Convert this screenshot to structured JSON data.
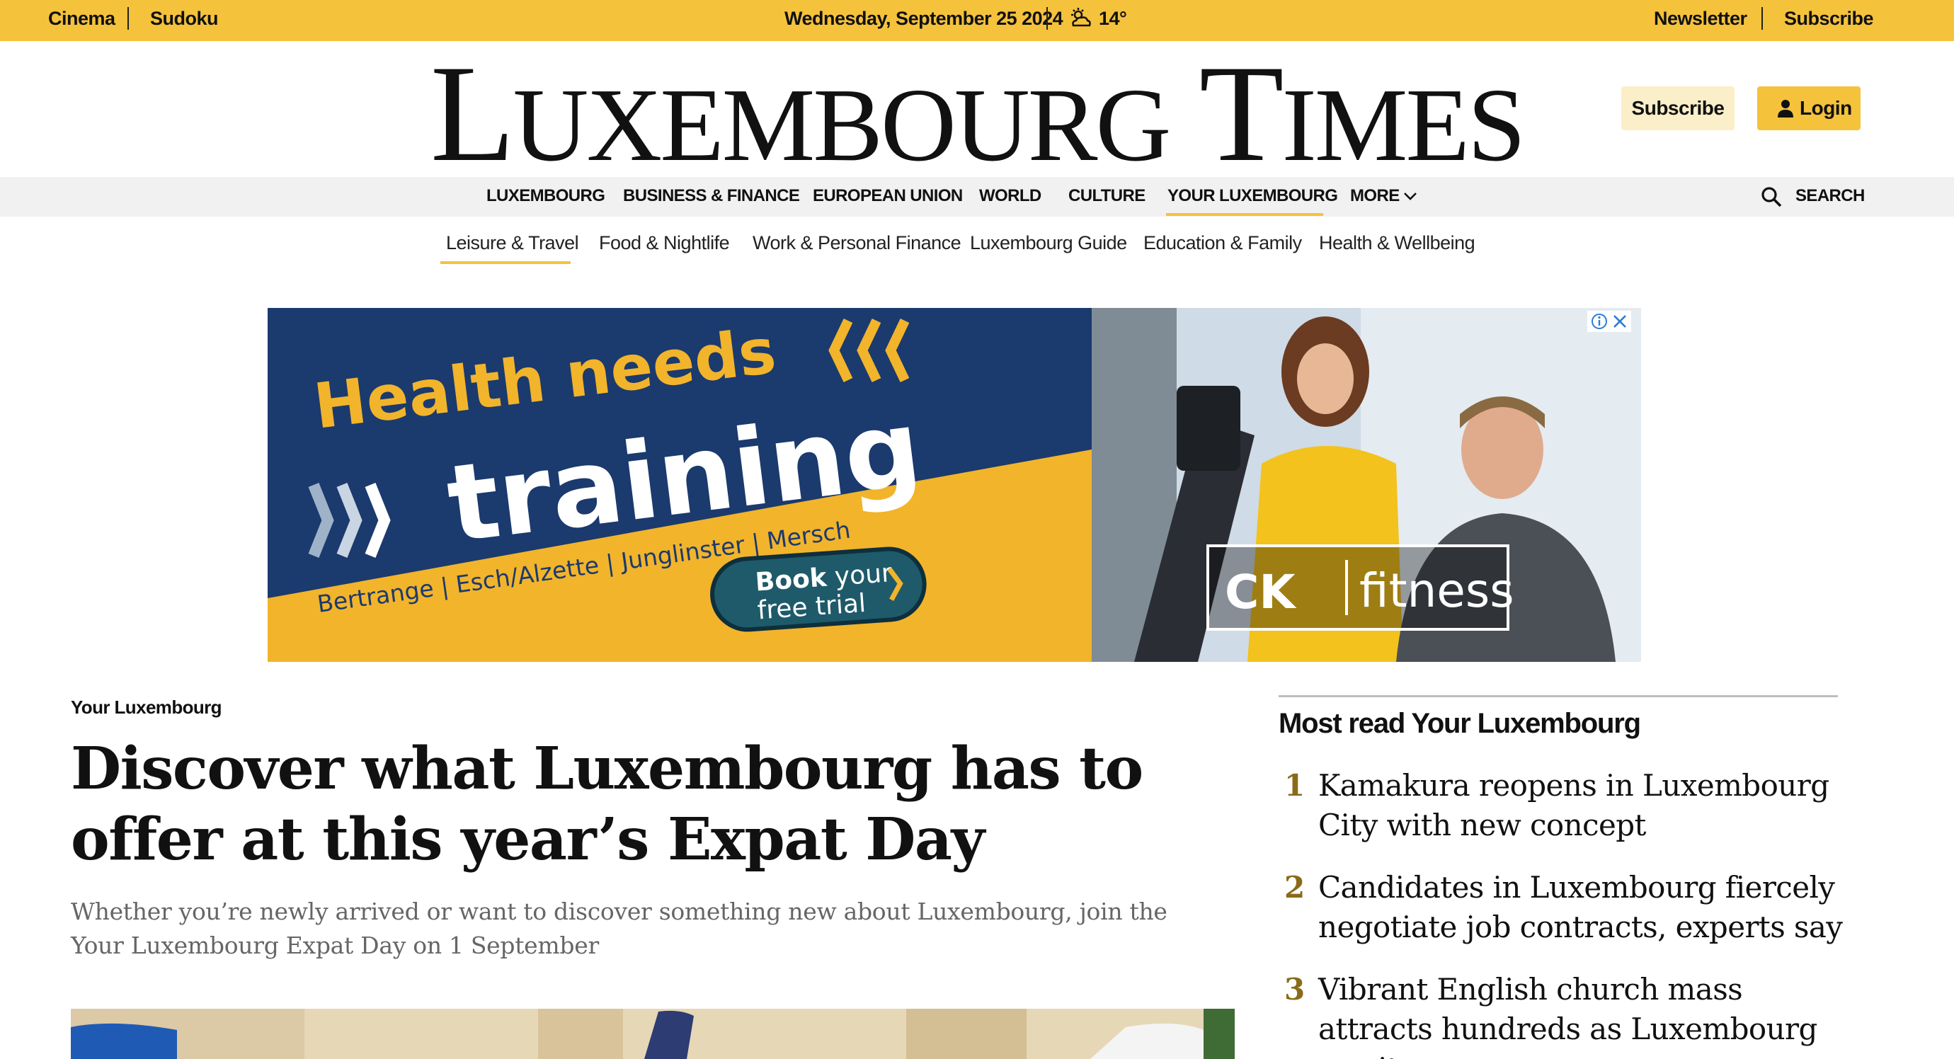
{
  "topbar": {
    "left_links": [
      "Cinema",
      "Sudoku"
    ],
    "date": "Wednesday, September 25 2024",
    "weather_icon": "partly-cloudy-icon",
    "temperature": "14°",
    "right_links": [
      "Newsletter",
      "Subscribe"
    ]
  },
  "masthead": {
    "logo_text": "Luxembourg Times",
    "subscribe_label": "Subscribe",
    "login_label": "Login"
  },
  "main_nav": {
    "items": [
      "LUXEMBOURG",
      "BUSINESS & FINANCE",
      "EUROPEAN UNION",
      "WORLD",
      "CULTURE",
      "YOUR LUXEMBOURG",
      "MORE"
    ],
    "active": "YOUR LUXEMBOURG",
    "search_label": "SEARCH"
  },
  "sub_nav": {
    "items": [
      "Leisure & Travel",
      "Food & Nightlife",
      "Work & Personal Finance",
      "Luxembourg Guide",
      "Education & Family",
      "Health & Wellbeing"
    ],
    "active": "Leisure & Travel"
  },
  "ad": {
    "line1": "Health needs",
    "line2": "training",
    "locations": "Bertrange | Esch/Alzette | Junglinster | Mersch",
    "cta_bold": "Book",
    "cta_rest1": " your",
    "cta_line2": "free trial",
    "brand_left": "CK",
    "brand_right": "fitness",
    "colors": {
      "navy": "#1b3a6e",
      "yellow": "#f2b42b",
      "teal": "#1e5a6a"
    }
  },
  "article": {
    "kicker": "Your Luxembourg",
    "headline": "Discover what Luxembourg has to offer at this year’s Expat Day",
    "standfirst": "Whether you’re newly arrived or want to discover something new about Luxembourg, join the Your Luxembourg Expat Day on 1 September"
  },
  "sidebar": {
    "title": "Most read Your Luxembourg",
    "items": [
      {
        "rank": "1",
        "title": "Kamakura reopens in Luxembourg City with new concept"
      },
      {
        "rank": "2",
        "title": "Candidates in Luxembourg fiercely negotiate job contracts, experts say"
      },
      {
        "rank": "3",
        "title": "Vibrant English church mass attracts hundreds as Luxembourg awaits"
      }
    ]
  },
  "colors": {
    "brand_yellow": "#f5c23c",
    "light_yellow": "#fbefc9",
    "nav_gray": "#f1f1f1",
    "rank_gold": "#8a6a1a"
  }
}
